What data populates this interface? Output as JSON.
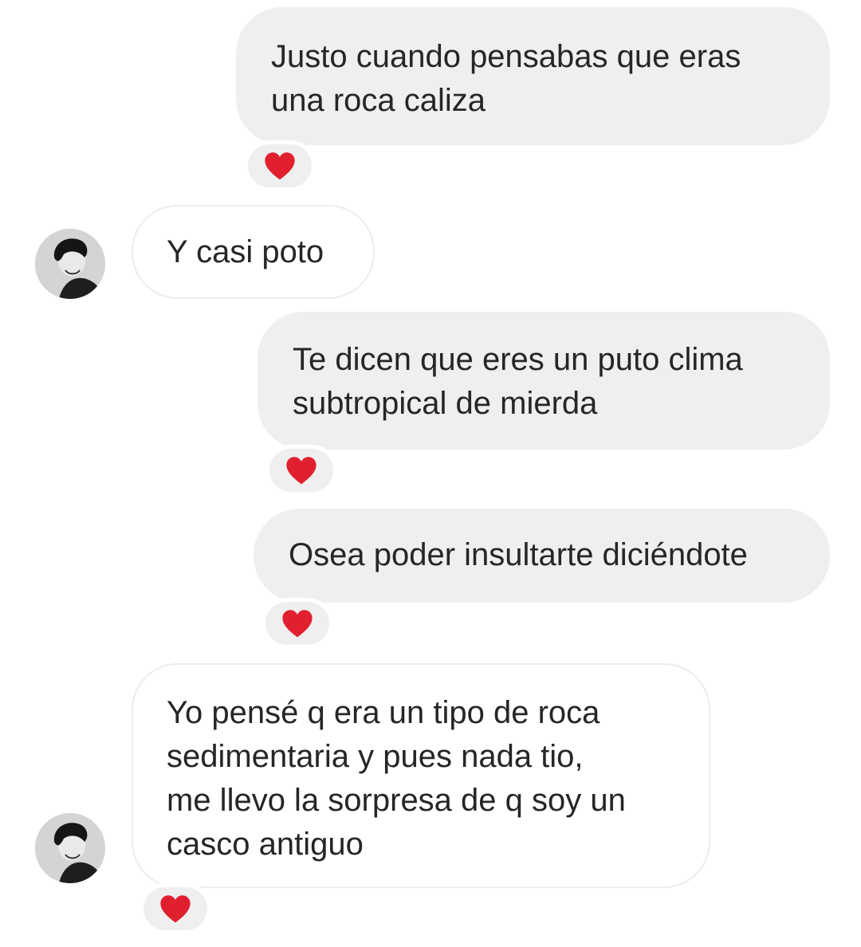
{
  "messages": [
    {
      "direction": "outgoing",
      "text": "Justo cuando pensabas que eras\nuna roca caliza",
      "reaction": "heart"
    },
    {
      "direction": "incoming",
      "text": "Y casi poto",
      "reaction": ""
    },
    {
      "direction": "outgoing",
      "text": "Te dicen que eres un puto clima\nsubtropical de mierda",
      "reaction": "heart"
    },
    {
      "direction": "outgoing",
      "text": "Osea poder insultarte diciéndote",
      "reaction": "heart"
    },
    {
      "direction": "incoming",
      "text": "Yo pensé q era un tipo de roca\nsedimentaria y pues nada tio,\nme llevo la sorpresa de q soy un\ncasco antiguo",
      "reaction": "heart"
    }
  ],
  "icons": {
    "reaction": "red-heart-icon",
    "avatar": "profile-avatar"
  },
  "colors": {
    "outgoing_bubble": "#efefef",
    "incoming_bubble": "#ffffff",
    "heart": "#e0202e",
    "text": "#262626"
  }
}
